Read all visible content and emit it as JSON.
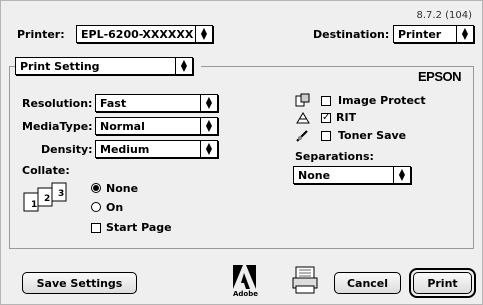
{
  "version": "8.7.2 (104)",
  "printer": {
    "label": "Printer:",
    "value": "EPL-6200-XXXXXX"
  },
  "destination": {
    "label": "Destination:",
    "value": "Printer"
  },
  "panel": {
    "value": "Print Setting"
  },
  "brand": "EPSON",
  "settings": {
    "resolution": {
      "label": "Resolution:",
      "value": "Fast"
    },
    "mediatype": {
      "label": "MediaType:",
      "value": "Normal"
    },
    "density": {
      "label": "Density:",
      "value": "Medium"
    }
  },
  "collate": {
    "label": "Collate:",
    "options": [
      {
        "label": "None",
        "selected": true
      },
      {
        "label": "On",
        "selected": false
      }
    ],
    "start_page": {
      "label": "Start Page",
      "checked": false
    }
  },
  "options": {
    "image_protect": {
      "label": "Image Protect",
      "checked": false
    },
    "rit": {
      "label": "RIT",
      "checked": true
    },
    "toner_save": {
      "label": "Toner Save",
      "checked": false
    }
  },
  "separations": {
    "label": "Separations:",
    "value": "None"
  },
  "buttons": {
    "save_settings": "Save Settings",
    "cancel": "Cancel",
    "print": "Print"
  },
  "adobe": {
    "label": "Adobe"
  }
}
